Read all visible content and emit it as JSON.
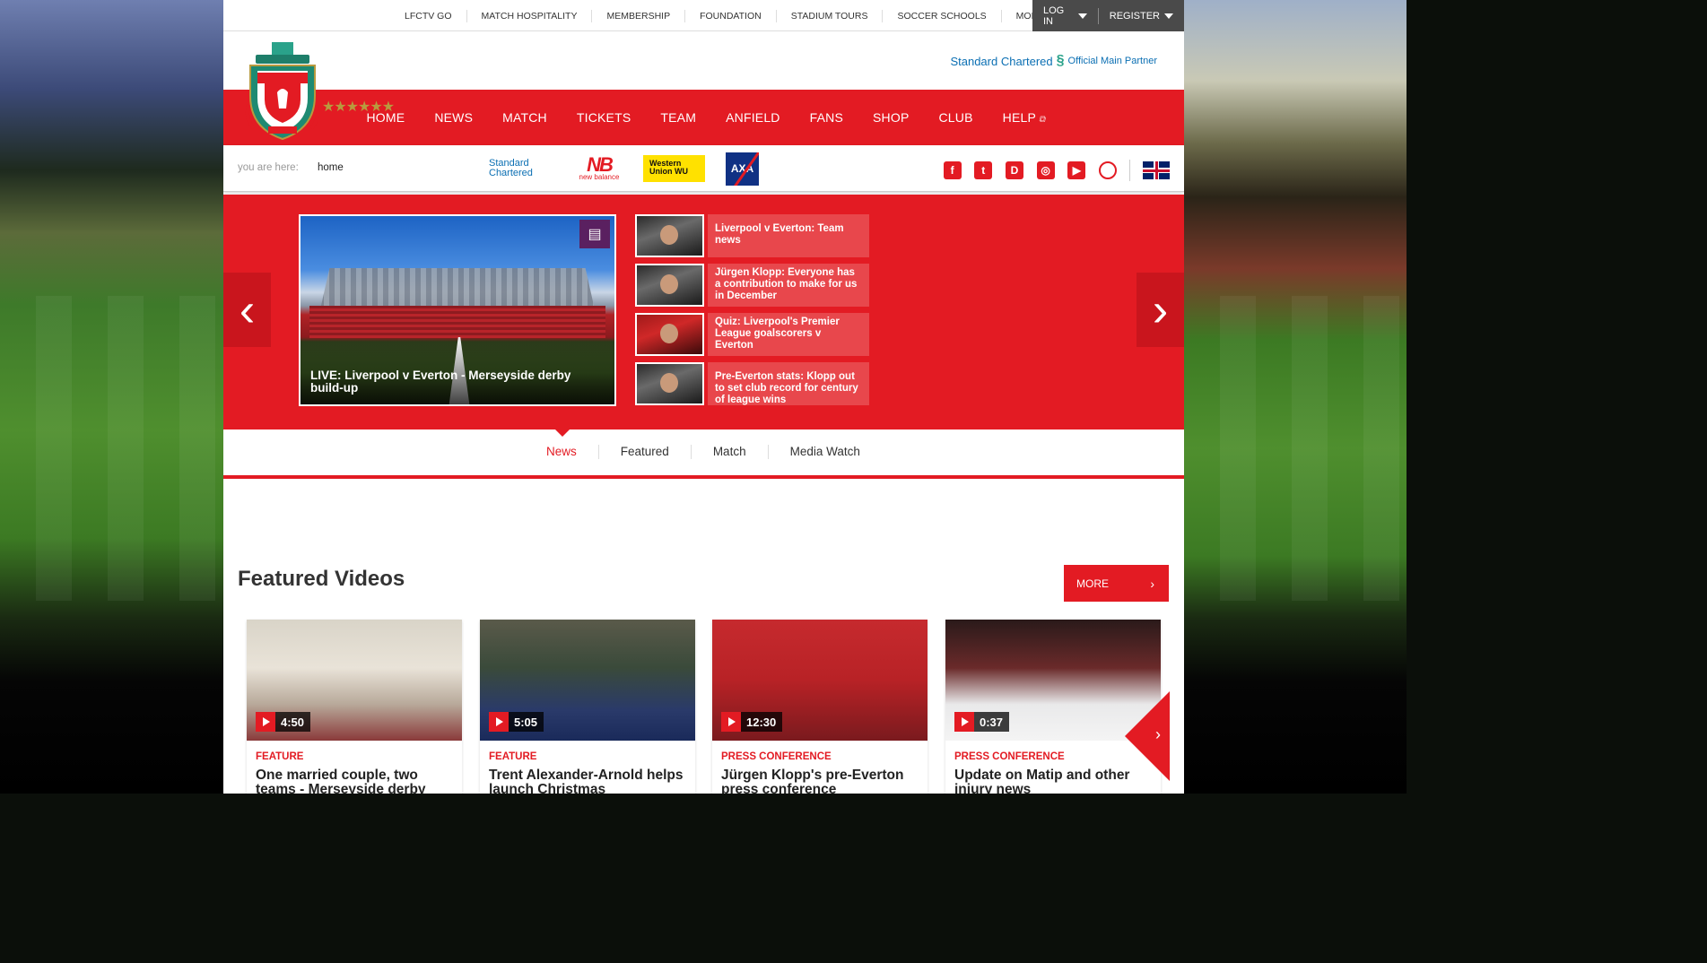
{
  "top_links": [
    "LFCTV GO",
    "MATCH HOSPITALITY",
    "MEMBERSHIP",
    "FOUNDATION",
    "STADIUM TOURS",
    "SOCCER SCHOOLS"
  ],
  "top_more": "MORE",
  "auth": {
    "login": "LOG IN",
    "register": "REGISTER"
  },
  "header": {
    "stars": "★★★★★★",
    "partner_name": "Standard Chartered",
    "partner_label": "Official Main Partner"
  },
  "nav": [
    "HOME",
    "NEWS",
    "MATCH",
    "TICKETS",
    "TEAM",
    "ANFIELD",
    "FANS",
    "SHOP",
    "CLUB",
    "HELP"
  ],
  "breadcrumb": {
    "label": "you are here:",
    "current": "home"
  },
  "sponsors": {
    "sc": "Standard Chartered",
    "nb": "new balance",
    "wu": "Western Union WU",
    "axa": "AXA"
  },
  "hero": {
    "main_title": "LIVE: Liverpool v Everton - Merseyside derby build-up",
    "stories": [
      "Liverpool v Everton: Team news",
      "Jürgen Klopp: Everyone has a contribution to make for us in December",
      "Quiz: Liverpool's Premier League goalscorers v Everton",
      "Pre-Everton stats: Klopp out to set club record for century of league wins"
    ]
  },
  "tabs": [
    "News",
    "Featured",
    "Match",
    "Media Watch"
  ],
  "featured_videos": {
    "title": "Featured Videos",
    "more": "MORE",
    "items": [
      {
        "duration": "4:50",
        "category": "FEATURE",
        "title": "One married couple, two teams - Merseyside derby"
      },
      {
        "duration": "5:05",
        "category": "FEATURE",
        "title": "Trent Alexander-Arnold helps launch Christmas"
      },
      {
        "duration": "12:30",
        "category": "PRESS CONFERENCE",
        "title": "Jürgen Klopp's pre-Everton press conference"
      },
      {
        "duration": "0:37",
        "category": "PRESS CONFERENCE",
        "title": "Update on Matip and other injury news"
      }
    ]
  },
  "colors": {
    "brand_red": "#e31b23",
    "dark_grey": "#4a4a4a",
    "sc_blue": "#0b6fb3"
  }
}
